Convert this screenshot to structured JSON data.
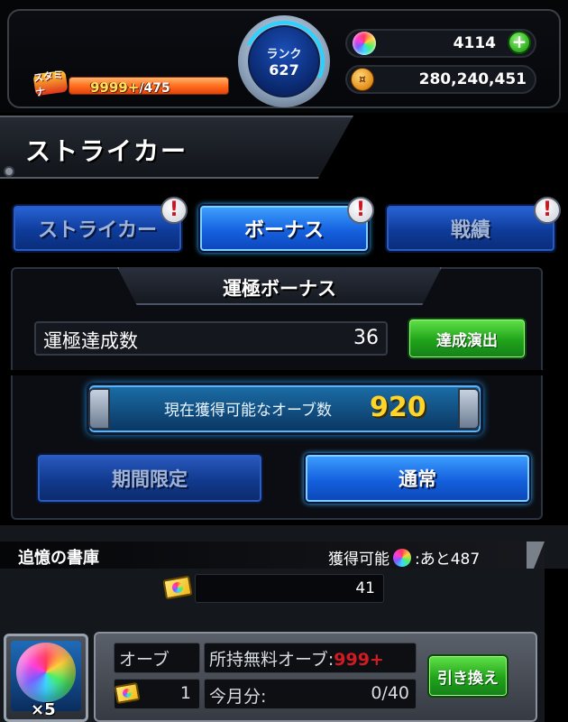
{
  "header": {
    "stamina_icon_label": "スタミナ",
    "stamina_current": "9999+",
    "stamina_max": "/475",
    "rank_label": "ランク",
    "rank_value": "627",
    "orb_count": "4114",
    "gold_count": "280,240,451",
    "icons": {
      "orb": "orb-icon",
      "coin": "gold-coin-icon",
      "plus": "plus-icon"
    }
  },
  "page_title": "ストライカー",
  "tabs": [
    {
      "label": "ストライカー",
      "active": false,
      "alert": "!"
    },
    {
      "label": "ボーナス",
      "active": true,
      "alert": "!"
    },
    {
      "label": "戦績",
      "active": false,
      "alert": "!"
    }
  ],
  "bonus": {
    "panel_title": "運極ボーナス",
    "achievement_label": "運極達成数",
    "achievement_value": "36",
    "show_button": "達成演出",
    "orb_bar_label": "現在獲得可能なオーブ数",
    "orb_bar_value": "920",
    "modes": [
      {
        "label": "期間限定",
        "active": false
      },
      {
        "label": "通常",
        "active": true
      }
    ]
  },
  "memory": {
    "title": "追憶の書庫",
    "obtainable_label": "獲得可能",
    "remaining": ":あと487",
    "ticket_count": "41",
    "orb_label": "オーブ",
    "orb_multiplier": "×5",
    "ticket_count_small": "1",
    "free_orbs_label": "所持無料オーブ:",
    "free_orbs_value": "999+",
    "monthly_label": "今月分:",
    "monthly_value": "0/40",
    "exchange_button": "引き換え"
  },
  "colors": {
    "tab_active": "#1561e0",
    "tab_inactive": "#0e3b9a",
    "green_button": "#1fa319",
    "orb_value": "#ffd52a",
    "warning_red": "#d11b22"
  }
}
